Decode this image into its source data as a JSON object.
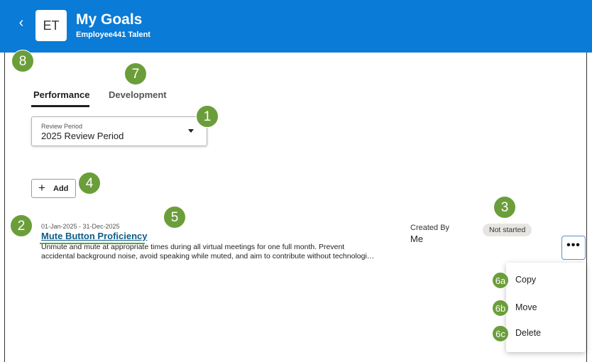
{
  "header": {
    "back_icon": "chevron-left-icon",
    "avatar_initials": "ET",
    "title": "My Goals",
    "subtitle": "Employee441 Talent",
    "background_color": "#0a7bd6"
  },
  "tabs": [
    {
      "label": "Performance",
      "active": true
    },
    {
      "label": "Development",
      "active": false
    }
  ],
  "review_period": {
    "label": "Review Period",
    "value": "2025 Review Period"
  },
  "add_button": {
    "label": "Add",
    "icon": "plus-icon"
  },
  "goal": {
    "dates": "01-Jan-2025 - 31-Dec-2025",
    "title": "Mute Button Proficiency",
    "description_line1": "Unmute and mute at appropriate times during all virtual meetings for one full month. Prevent",
    "description_line2": "accidental background noise, avoid speaking while muted, and aim to contribute without technologi…",
    "created_by_label": "Created By",
    "created_by_value": "Me",
    "status": "Not started"
  },
  "actions_menu": {
    "button_icon": "more-horizontal-icon",
    "button_glyph": "•••",
    "items": [
      "Copy",
      "Move",
      "Delete"
    ]
  },
  "callouts": {
    "c1": "1",
    "c2": "2",
    "c3": "3",
    "c4": "4",
    "c5": "5",
    "c6a": "6a",
    "c6b": "6b",
    "c6c": "6c",
    "c7": "7",
    "c8": "8",
    "color": "#6b9e3a"
  }
}
